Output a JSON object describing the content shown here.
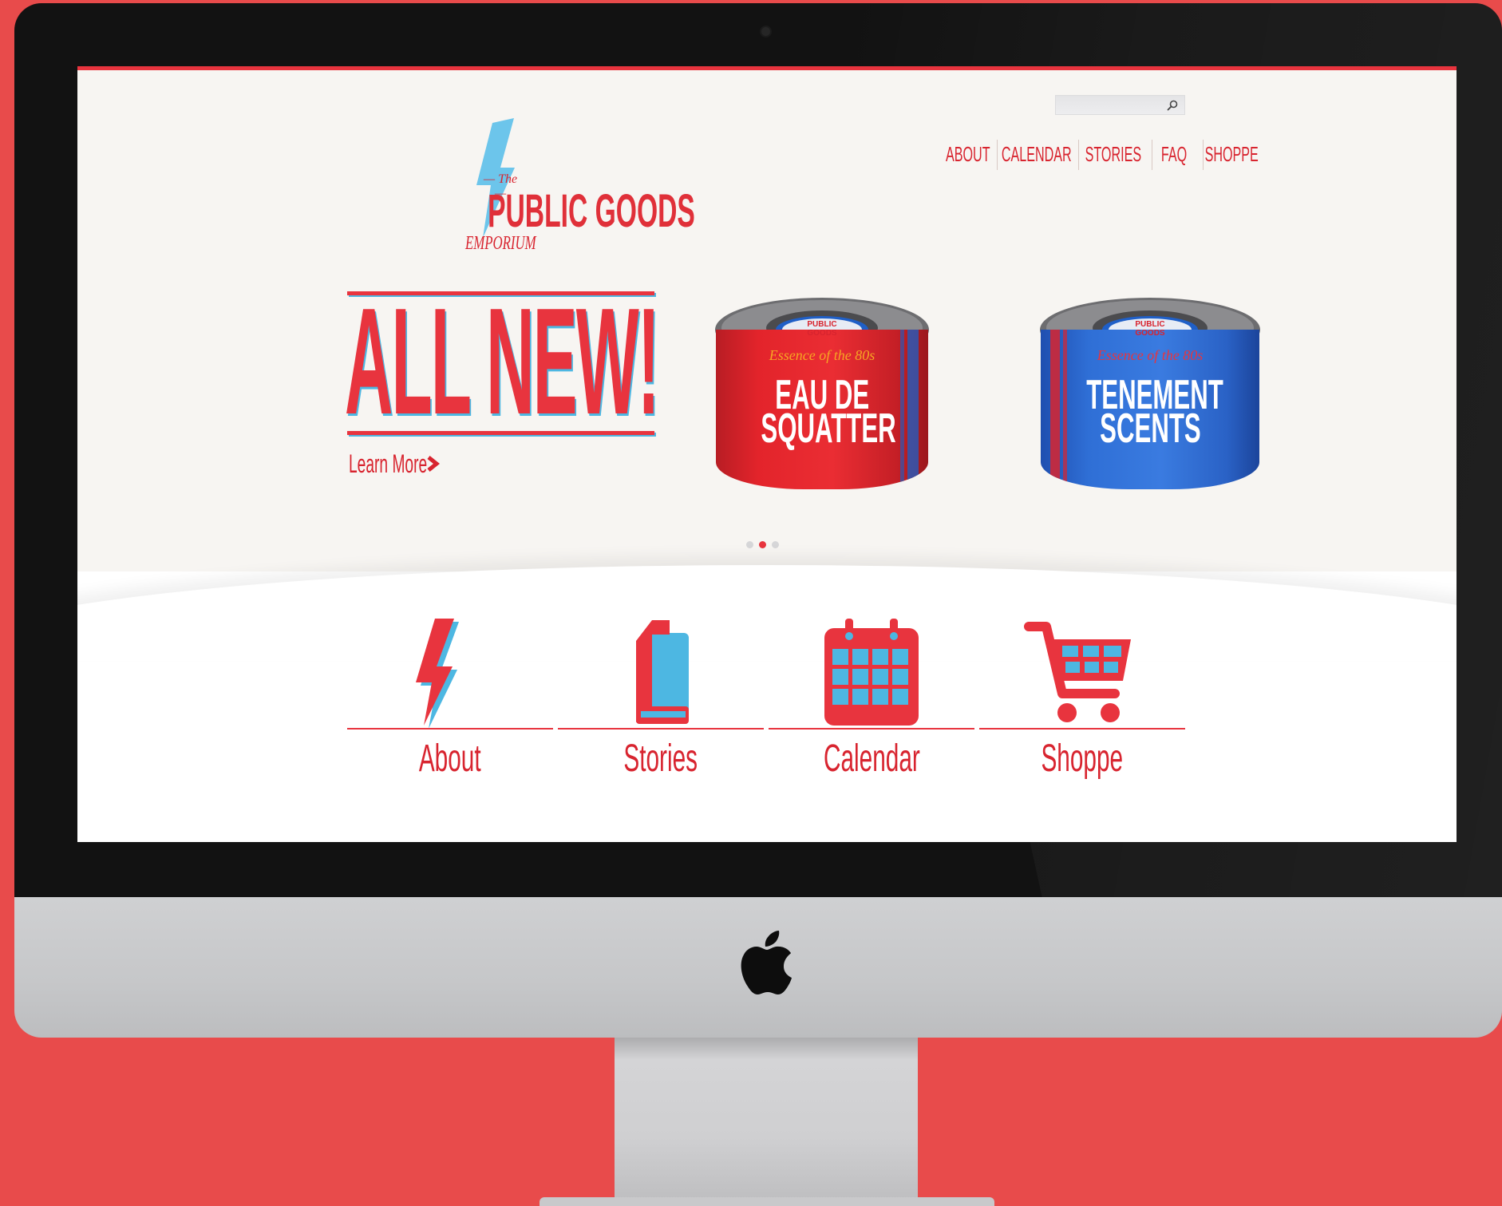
{
  "search": {
    "placeholder": ""
  },
  "nav": {
    "items": [
      {
        "label": "ABOUT"
      },
      {
        "label": "CALENDAR"
      },
      {
        "label": "STORIES"
      },
      {
        "label": "FAQ"
      },
      {
        "label": "SHOPPE"
      }
    ]
  },
  "logo": {
    "the": "— The —",
    "main": "PUBLIC GOODS",
    "sub": "EMPORIUM"
  },
  "hero": {
    "headline": "ALL NEW!",
    "cta": "Learn More",
    "products": [
      {
        "essence": "Essence of the 80s",
        "title_line1": "EAU DE",
        "title_line2": "SQUATTER",
        "lid": "PUBLIC GOODS",
        "color": "#e3242b"
      },
      {
        "essence": "Essence of the 80s",
        "title_line1": "TENEMENT",
        "title_line2": "SCENTS",
        "lid": "PUBLIC GOODS",
        "color": "#2f6fd6"
      }
    ],
    "carousel": {
      "count": 3,
      "active": 2
    }
  },
  "features": [
    {
      "label": "About",
      "icon": "lightning-bolt-icon"
    },
    {
      "label": "Stories",
      "icon": "book-icon"
    },
    {
      "label": "Calendar",
      "icon": "calendar-icon"
    },
    {
      "label": "Shoppe",
      "icon": "shopping-cart-icon"
    }
  ],
  "colors": {
    "background": "#e84b4b",
    "accent_red": "#e8343e",
    "accent_blue": "#4db7e2",
    "hero_bg": "#f7f5f2"
  }
}
